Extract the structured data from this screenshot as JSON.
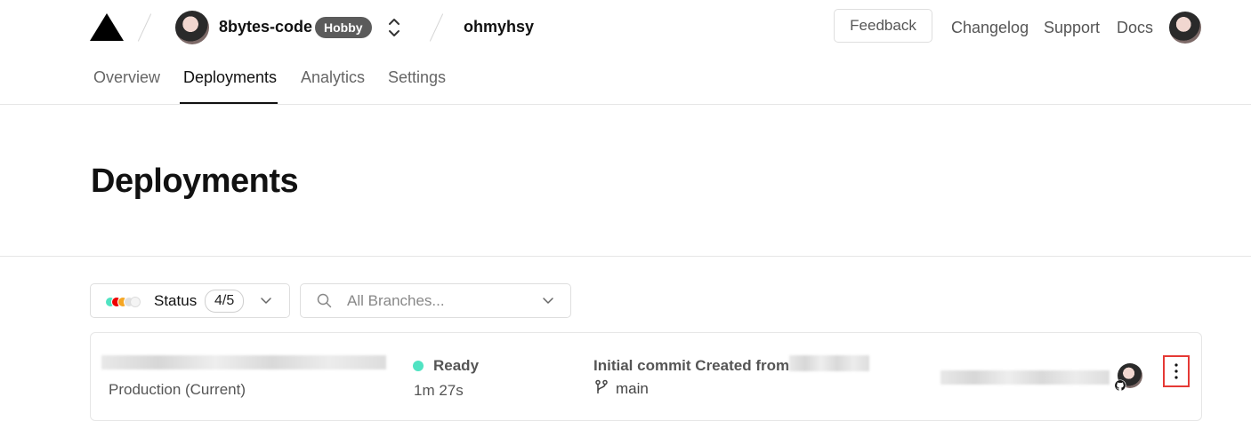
{
  "header": {
    "team_name": "8bytes-code",
    "plan_badge": "Hobby",
    "project_name": "ohmyhsy",
    "feedback_label": "Feedback",
    "links": [
      "Changelog",
      "Support",
      "Docs"
    ]
  },
  "tabs": [
    "Overview",
    "Deployments",
    "Analytics",
    "Settings"
  ],
  "active_tab": "Deployments",
  "page_title": "Deployments",
  "filters": {
    "status_label": "Status",
    "status_count": "4/5",
    "branch_placeholder": "All Branches...",
    "status_dot_colors": [
      "#50e3c2",
      "#ee0000",
      "#f5a623",
      "#e0e0e0",
      "#f4f4f4"
    ]
  },
  "deployment": {
    "environment": "Production (Current)",
    "status": "Ready",
    "status_color": "#50e3c2",
    "duration": "1m 27s",
    "commit_message": "Initial commit Created from",
    "branch": "main"
  },
  "colors": {
    "highlight_border": "#e53935",
    "badge_bg": "#5b5b5b"
  }
}
